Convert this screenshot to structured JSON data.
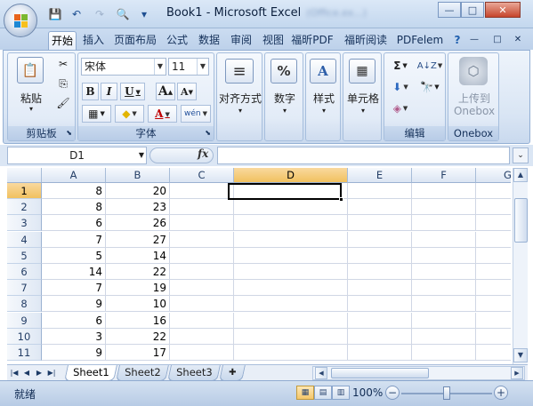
{
  "title": {
    "doc": "Book1",
    "sep": " - ",
    "app": "Microsoft Excel",
    "blurred": "(Office.ex...)"
  },
  "qat": {
    "save": "💾",
    "undo": "↶",
    "redo": "↷",
    "preview": "🔍",
    "customize": "▾"
  },
  "window_buttons": {
    "minimize": "—",
    "maximize": "□",
    "close": "✕"
  },
  "tabs": [
    "开始",
    "插入",
    "页面布局",
    "公式",
    "数据",
    "审阅",
    "视图",
    "福昕PDF",
    "福昕阅读",
    "PDFelem"
  ],
  "active_tab": 0,
  "tab_right": {
    "help": "?",
    "min": "—",
    "restore": "□",
    "close": "✕"
  },
  "ribbon": {
    "clipboard": {
      "label": "剪贴板",
      "paste": "粘贴",
      "paste_arrow": "▾",
      "cut": "✂",
      "copy": "⎘",
      "format_painter": "🖌"
    },
    "font": {
      "label": "字体",
      "name": "宋体",
      "size": "11",
      "bold": "B",
      "italic": "I",
      "underline": "U",
      "grow": "A",
      "shrink": "A",
      "border": "▦",
      "fill": "◆",
      "color": "A",
      "phonetic": "wén"
    },
    "alignment": {
      "label": "对齐方式",
      "arrow": "▾"
    },
    "number": {
      "label": "数字",
      "symbol": "%",
      "arrow": "▾"
    },
    "styles": {
      "label": "样式",
      "arrow": "▾"
    },
    "cells": {
      "label": "单元格",
      "arrow": "▾"
    },
    "editing": {
      "label": "编辑",
      "sum": "Σ",
      "sort": "A↓Z",
      "fill": "⬇",
      "find": "🔭",
      "clear": "◈"
    },
    "onebox": {
      "label": "Onebox",
      "upload1": "上传到",
      "upload2": "Onebox"
    }
  },
  "formula_bar": {
    "name_box": "D1",
    "fx": "fx",
    "value": "",
    "expand": "⌄"
  },
  "colors": {
    "selected_header": "#f4c96e",
    "grid_line": "#d0d7e5",
    "header_bg": "#dfe8f4"
  },
  "columns": [
    "A",
    "B",
    "C",
    "D",
    "E",
    "F",
    "G"
  ],
  "selected_column": "D",
  "rows": [
    {
      "n": "1",
      "a": "8",
      "b": "20"
    },
    {
      "n": "2",
      "a": "8",
      "b": "23"
    },
    {
      "n": "3",
      "a": "6",
      "b": "26"
    },
    {
      "n": "4",
      "a": "7",
      "b": "27"
    },
    {
      "n": "5",
      "a": "5",
      "b": "14"
    },
    {
      "n": "6",
      "a": "14",
      "b": "22"
    },
    {
      "n": "7",
      "a": "7",
      "b": "19"
    },
    {
      "n": "8",
      "a": "9",
      "b": "10"
    },
    {
      "n": "9",
      "a": "6",
      "b": "16"
    },
    {
      "n": "10",
      "a": "3",
      "b": "22"
    },
    {
      "n": "11",
      "a": "9",
      "b": "17"
    }
  ],
  "selected_row": "1",
  "sheets": [
    "Sheet1",
    "Sheet2",
    "Sheet3"
  ],
  "active_sheet": 0,
  "sheet_nav": [
    "|◀",
    "◀",
    "▶",
    "▶|"
  ],
  "status": {
    "text": "就绪",
    "zoom": "100%",
    "minus": "−",
    "plus": "+"
  }
}
